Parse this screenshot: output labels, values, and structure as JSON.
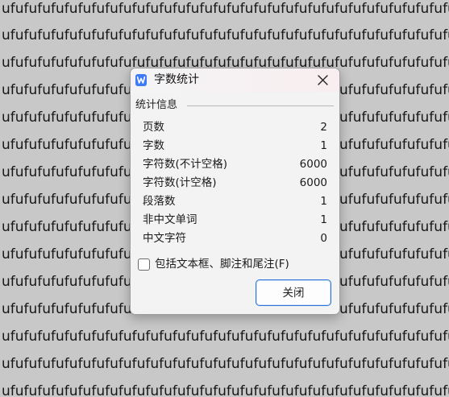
{
  "document": {
    "background_text": "ufufufufufufufufufufufufufufufufufufufufufufufufufufufufufufufufufufufuf"
  },
  "dialog": {
    "title": "字数统计",
    "app_icon": "wps-writer-icon",
    "close_icon": "close-icon",
    "group_title": "统计信息",
    "stats": [
      {
        "label": "页数",
        "value": "2"
      },
      {
        "label": "字数",
        "value": "1"
      },
      {
        "label": "字符数(不计空格)",
        "value": "6000"
      },
      {
        "label": "字符数(计空格)",
        "value": "6000"
      },
      {
        "label": "段落数",
        "value": "1"
      },
      {
        "label": "非中文单词",
        "value": "1"
      },
      {
        "label": "中文字符",
        "value": "0"
      }
    ],
    "include_checkbox": {
      "label": "包括文本框、脚注和尾注(F)",
      "checked": false
    },
    "close_button": "关闭"
  },
  "colors": {
    "accent": "#2b72d9",
    "icon_blue": "#3f7bf6",
    "document_bg": "#c8c8c8"
  }
}
